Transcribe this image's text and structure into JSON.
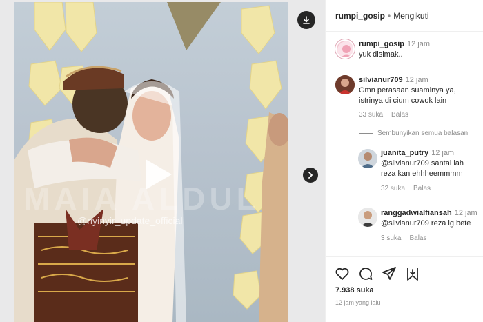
{
  "video": {
    "watermark": "@nyinyir_update_official",
    "bg_text": "MAIA ALDUL"
  },
  "header": {
    "username": "rumpi_gosip",
    "separator": "•",
    "follow_status": "Mengikuti"
  },
  "caption": {
    "username": "rumpi_gosip",
    "time": "12 jam",
    "text": "yuk disimak.."
  },
  "comments": [
    {
      "username": "silvianur709",
      "time": "12 jam",
      "lines": [
        "Gmn perasaan suaminya ya,",
        "istrinya di cium cowok lain"
      ],
      "likes": "33 suka",
      "reply": "Balas"
    }
  ],
  "hide_replies": "Sembunyikan semua balasan",
  "replies": [
    {
      "username": "juanita_putry",
      "time": "12 jam",
      "lines": [
        "@silvianur709 santai lah",
        "reza kan ehhheemmmm"
      ],
      "likes": "32 suka",
      "reply": "Balas"
    },
    {
      "username": "ranggadwialfiansah",
      "time": "12 jam",
      "lines": [
        "@silvianur709 reza lg bete"
      ],
      "likes": "3 suka",
      "reply": "Balas"
    }
  ],
  "footer": {
    "likes": "7.938 suka",
    "posted": "12 jam yang lalu"
  }
}
